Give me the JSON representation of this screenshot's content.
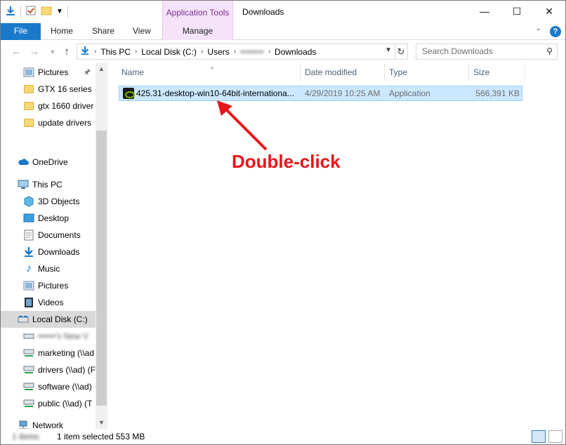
{
  "window": {
    "title": "Downloads",
    "contextual_tab_group": "Application Tools"
  },
  "ribbon": {
    "tabs": [
      "File",
      "Home",
      "Share",
      "View",
      "Manage"
    ]
  },
  "address": {
    "crumbs": [
      "This PC",
      "Local Disk (C:)",
      "Users",
      "••••••••",
      "Downloads"
    ],
    "search_placeholder": "Search Downloads"
  },
  "nav": {
    "quick_access": [
      "Pictures",
      "GTX 16 series",
      "gtx 1660 driver",
      "update drivers"
    ],
    "onedrive": "OneDrive",
    "this_pc": "This PC",
    "pc_items": [
      "3D Objects",
      "Desktop",
      "Documents",
      "Downloads",
      "Music",
      "Pictures",
      "Videos",
      "Local Disk (C:)"
    ],
    "drives": [
      "••••••'s New V",
      "marketing (\\\\ad",
      "drivers (\\\\ad) (F",
      "software (\\\\ad)",
      "public (\\\\ad) (T"
    ],
    "network": "Network"
  },
  "columns": [
    "Name",
    "Date modified",
    "Type",
    "Size"
  ],
  "files": [
    {
      "name": "425.31-desktop-win10-64bit-internationa...",
      "date": "4/29/2019 10:25 AM",
      "type": "Application",
      "size": "566,391 KB"
    }
  ],
  "annotation": "Double-click",
  "status": {
    "count": "1 items",
    "selected": "1 item selected",
    "size": "553 MB"
  },
  "colors": {
    "accent": "#1979ca",
    "contextual_tab": "#f5e3f9",
    "selection": "#cce8ff",
    "annotation": "#e8141a"
  }
}
